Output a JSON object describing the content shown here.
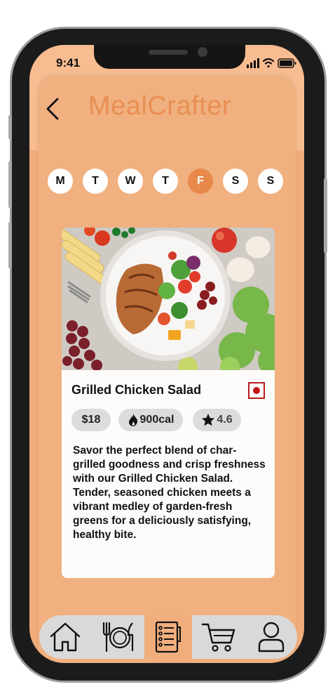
{
  "status_bar": {
    "time": "9:41",
    "signal_icon": "signal-icon",
    "wifi_icon": "wifi-icon",
    "battery_icon": "battery-icon"
  },
  "header": {
    "title": "MealCrafter",
    "back_icon": "chevron-left-icon"
  },
  "week_days": [
    {
      "label": "M",
      "active": false
    },
    {
      "label": "T",
      "active": false
    },
    {
      "label": "W",
      "active": false
    },
    {
      "label": "T",
      "active": false
    },
    {
      "label": "F",
      "active": true
    },
    {
      "label": "S",
      "active": false
    },
    {
      "label": "S",
      "active": false
    }
  ],
  "meal_card": {
    "image_icon": "grilled-chicken-salad-photo",
    "title": "Grilled Chicken Salad",
    "diet_badge_icon": "non-veg-mark-icon",
    "price": "$18",
    "calories": "900cal",
    "calories_icon": "flame-icon",
    "rating": "4.6",
    "rating_icon": "star-icon",
    "description": "Savor the perfect blend of char-grilled goodness and crisp freshness with our Grilled Chicken Salad. Tender, seasoned chicken meets a vibrant medley of garden-fresh greens for a deliciously satisfying, healthy bite."
  },
  "bottom_nav": [
    {
      "icon": "home-icon",
      "active": false
    },
    {
      "icon": "plate-cutlery-icon",
      "active": false
    },
    {
      "icon": "meal-plan-list-icon",
      "active": true
    },
    {
      "icon": "cart-icon",
      "active": false
    },
    {
      "icon": "profile-icon",
      "active": false
    }
  ],
  "colors": {
    "accent": "#e8894a",
    "title": "#e98f52",
    "background": "#f1ae7c",
    "chip": "#dcdcdc",
    "badge_red": "#c3141b"
  }
}
